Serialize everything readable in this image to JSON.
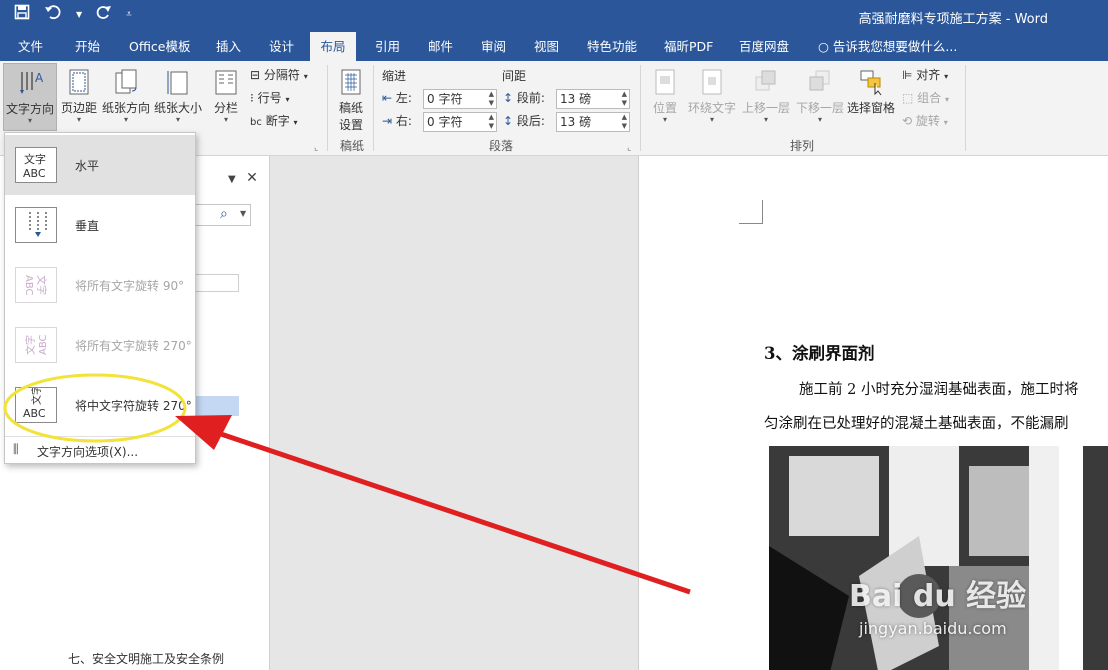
{
  "title_bar": {
    "document_title": "高强耐磨料专项施工方案 - Word",
    "qat": {
      "save_icon": "save-icon",
      "undo_icon": "undo-icon",
      "redo_icon": "redo-icon",
      "customize_icon": "customize-qat-icon"
    }
  },
  "tabs": [
    {
      "label": "文件"
    },
    {
      "label": "开始"
    },
    {
      "label": "Office模板"
    },
    {
      "label": "插入"
    },
    {
      "label": "设计"
    },
    {
      "label": "布局"
    },
    {
      "label": "引用"
    },
    {
      "label": "邮件"
    },
    {
      "label": "审阅"
    },
    {
      "label": "视图"
    },
    {
      "label": "特色功能"
    },
    {
      "label": "福昕PDF"
    },
    {
      "label": "百度网盘"
    },
    {
      "label": "告诉我您想要做什么..."
    }
  ],
  "active_tab": "布局",
  "ribbon": {
    "page_setup": {
      "text_direction": "文字方向",
      "margins": "页边距",
      "orientation": "纸张方向",
      "size": "纸张大小",
      "columns": "分栏",
      "breaks": "分隔符",
      "line_numbers": "行号",
      "hyphenation": "断字"
    },
    "manuscript": {
      "label": "稿纸\n设置",
      "line1": "稿纸",
      "line2": "设置",
      "group": "稿纸"
    },
    "paragraph": {
      "indent_heading": "缩进",
      "spacing_heading": "间距",
      "left_label": "左:",
      "right_label": "右:",
      "left_value": "0 字符",
      "right_value": "0 字符",
      "before_label": "段前:",
      "after_label": "段后:",
      "before_value": "13 磅",
      "after_value": "13 磅",
      "group": "段落"
    },
    "arrange": {
      "position": "位置",
      "wrap_text": "环绕文字",
      "bring_forward": "上移一层",
      "send_backward": "下移一层",
      "selection_pane": "选择窗格",
      "align": "对齐",
      "group_btn": "组合",
      "rotate": "旋转",
      "group": "排列"
    }
  },
  "text_direction_menu": {
    "options": [
      {
        "label": "水平",
        "icon_text": "文字\nABC",
        "enabled": true,
        "selected": true
      },
      {
        "label": "垂直",
        "enabled": true,
        "selected": false
      },
      {
        "label": "将所有文字旋转 90°",
        "enabled": false
      },
      {
        "label": "将所有文字旋转 270°",
        "enabled": false
      },
      {
        "label": "将中文字符旋转 270°",
        "enabled": true
      }
    ],
    "footer": "文字方向选项(X)..."
  },
  "nav_pane": {
    "bottom_heading": "七、安全文明施工及安全条例"
  },
  "document": {
    "heading": "3、涂刷界面剂",
    "para_line1": "施工前 2 小时充分湿润基础表面，施工时将",
    "para_line2": "匀涂刷在已处理好的混凝土基础表面，不能漏刷",
    "watermark": "Bai du 经验",
    "watermark_url": "jingyan.baidu.com"
  },
  "colors": {
    "word_blue": "#2b579a",
    "ribbon_bg": "#f3f3f3",
    "annotation_red": "#e02020",
    "annotation_yellow": "#f2e23a"
  }
}
